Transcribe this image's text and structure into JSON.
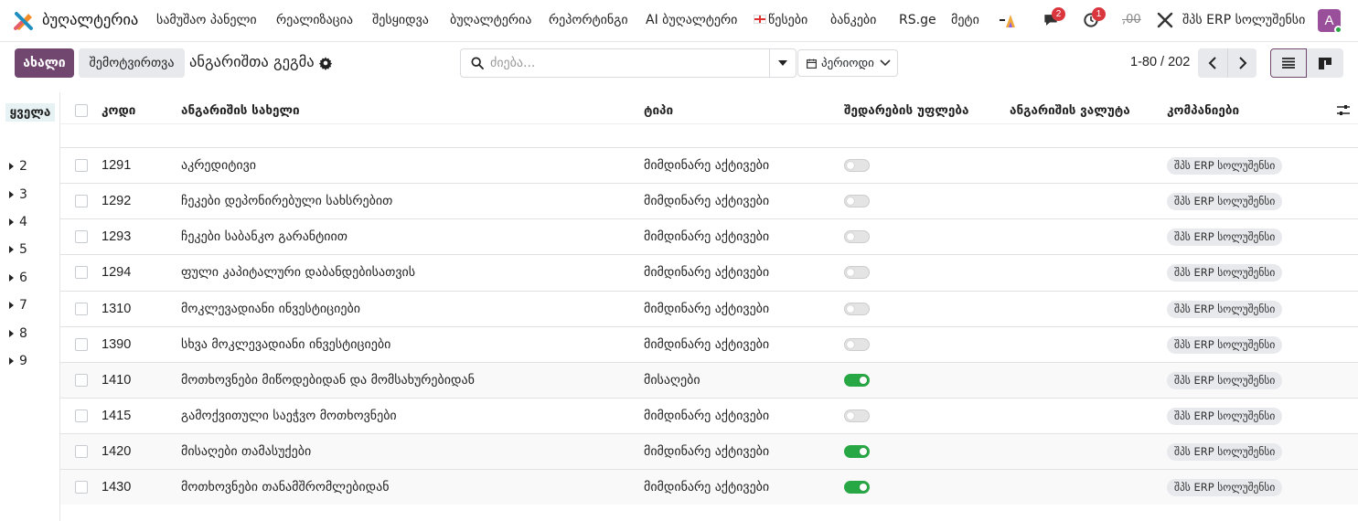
{
  "navbar": {
    "app_title": "ბუღალტერია",
    "menu": [
      {
        "label": "სამუშაო პანელი"
      },
      {
        "label": "რეალიზაცია"
      },
      {
        "label": "შესყიდვა"
      },
      {
        "label": "ბუღალტერია"
      },
      {
        "label": "რეპორტინგი"
      },
      {
        "label": "AI ბუღალტერი"
      },
      {
        "label": "წესები"
      },
      {
        "label": "ბანკები"
      },
      {
        "label": "RS.ge"
      },
      {
        "label": "მეტი"
      }
    ],
    "messages_badge": "2",
    "activities_badge": "1",
    "struck_value": ",00",
    "company": "შპს ERP სოლუშენსი",
    "avatar_letter": "A"
  },
  "control_panel": {
    "new_label": "ახალი",
    "import_label": "შემოტვირთვა",
    "page_title": "ანგარიშთა გეგმა",
    "search_placeholder": "ძიება...",
    "period_label": "პერიოდი",
    "pager": "1-80 / 202"
  },
  "sidebar": {
    "all_label": "ყველა",
    "groups": [
      "2",
      "3",
      "4",
      "5",
      "6",
      "7",
      "8",
      "9"
    ]
  },
  "table": {
    "headers": {
      "code": "კოდი",
      "name": "ანგარიშის სახელი",
      "type": "ტიპი",
      "reconcile": "შედარების უფლება",
      "currency": "ანგარიშის ვალუტა",
      "companies": "კომპანიები"
    },
    "rows": [
      {
        "code": "1291",
        "name": "აკრედიტივი",
        "type": "მიმდინარე აქტივები",
        "reconcile": false,
        "company": "შპს ERP სოლუშენსი"
      },
      {
        "code": "1292",
        "name": "ჩეკები დეპონირებული სახსრებით",
        "type": "მიმდინარე აქტივები",
        "reconcile": false,
        "company": "შპს ERP სოლუშენსი"
      },
      {
        "code": "1293",
        "name": "ჩეკები საბანკო გარანტიით",
        "type": "მიმდინარე აქტივები",
        "reconcile": false,
        "company": "შპს ERP სოლუშენსი"
      },
      {
        "code": "1294",
        "name": "ფული კაპიტალური დაბანდებისათვის",
        "type": "მიმდინარე აქტივები",
        "reconcile": false,
        "company": "შპს ERP სოლუშენსი"
      },
      {
        "code": "1310",
        "name": "მოკლევადიანი ინვესტიციები",
        "type": "მიმდინარე აქტივები",
        "reconcile": false,
        "company": "შპს ERP სოლუშენსი"
      },
      {
        "code": "1390",
        "name": "სხვა მოკლევადიანი ინვესტიციები",
        "type": "მიმდინარე აქტივები",
        "reconcile": false,
        "company": "შპს ERP სოლუშენსი"
      },
      {
        "code": "1410",
        "name": "მოთხოვნები მიწოდებიდან და მომსახურებიდან",
        "type": "მისაღები",
        "reconcile": true,
        "company": "შპს ERP სოლუშენსი"
      },
      {
        "code": "1415",
        "name": "გამოქვითული საეჭვო მოთხოვნები",
        "type": "მიმდინარე აქტივები",
        "reconcile": false,
        "company": "შპს ERP სოლუშენსი"
      },
      {
        "code": "1420",
        "name": "მისაღები თამასუქები",
        "type": "მიმდინარე აქტივები",
        "reconcile": true,
        "company": "შპს ERP სოლუშენსი"
      },
      {
        "code": "1430",
        "name": "მოთხოვნები თანამშრომლებიდან",
        "type": "მიმდინარე აქტივები",
        "reconcile": true,
        "company": "შპს ERP სოლუშენსი"
      }
    ]
  },
  "colors": {
    "brand": "#71476f",
    "toggle_on": "#28a745",
    "badge": "#d9363e",
    "selected_sidebar": "#e6f2f3"
  }
}
